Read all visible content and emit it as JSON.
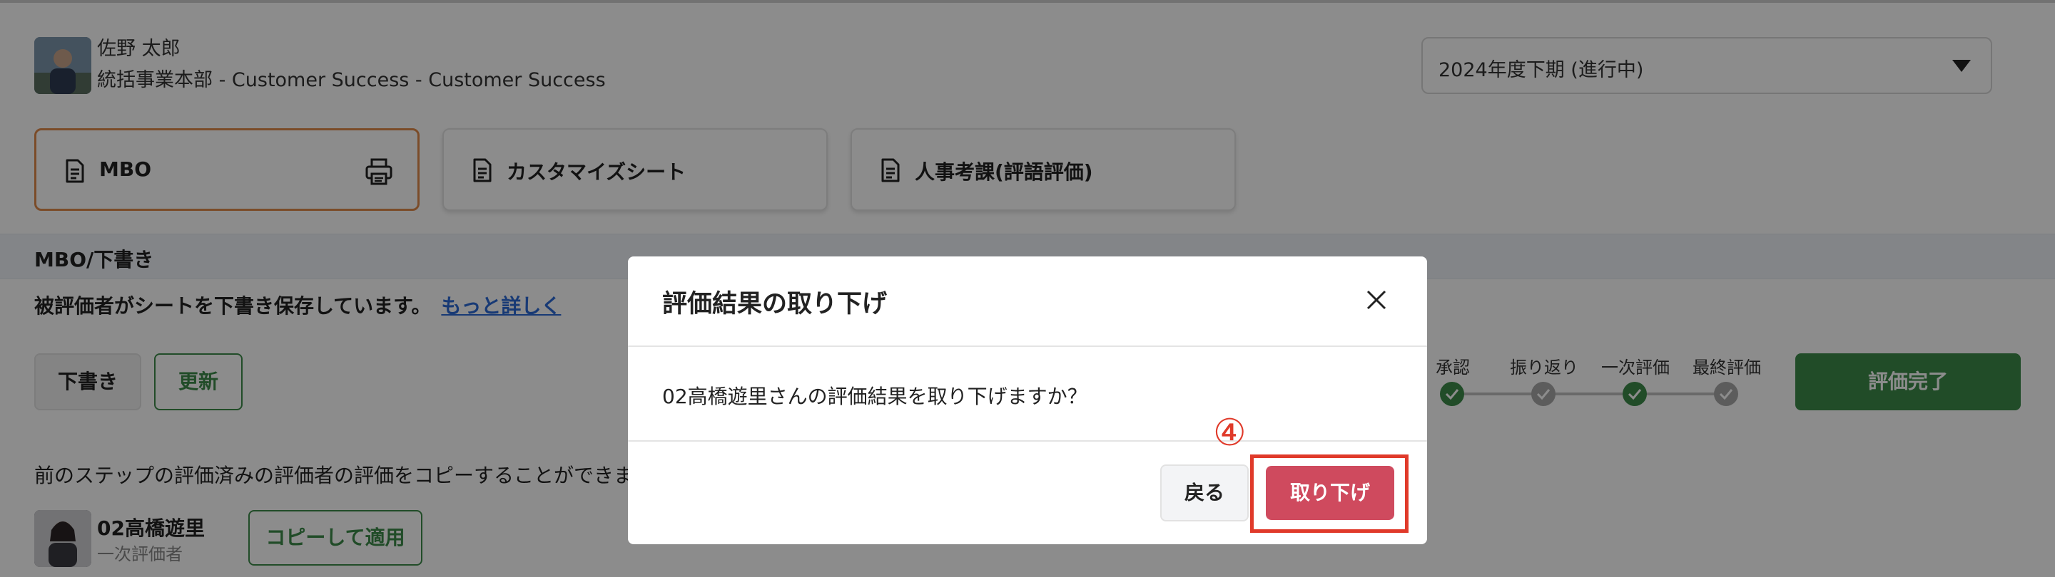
{
  "user": {
    "name": "佐野 太郎",
    "department": "統括事業本部 - Customer Success - Customer Success"
  },
  "period": {
    "selected": "2024年度下期 (進行中)"
  },
  "tabs": [
    {
      "label": "MBO",
      "active": true
    },
    {
      "label": "カスタマイズシート",
      "active": false
    },
    {
      "label": "人事考課(評語評価)",
      "active": false
    }
  ],
  "section": {
    "title": "MBO/下書き",
    "status_message": "被評価者がシートを下書き保存しています。",
    "more_link": "もっと詳しく"
  },
  "actions": {
    "draft_label": "下書き",
    "update_label": "更新",
    "complete_label": "評価完了"
  },
  "steps": [
    {
      "label": "承認",
      "state": "done"
    },
    {
      "label": "振り返り",
      "state": "pending"
    },
    {
      "label": "一次評価",
      "state": "done"
    },
    {
      "label": "最終評価",
      "state": "pending"
    }
  ],
  "copy_section": {
    "message": "前のステップの評価済みの評価者の評価をコピーすることができます",
    "evaluator_name": "02高橋遊里",
    "evaluator_role": "一次評価者",
    "copy_button": "コピーして適用"
  },
  "modal": {
    "title": "評価結果の取り下げ",
    "message": "02高橋遊里さんの評価結果を取り下げますか？",
    "back_label": "戻る",
    "withdraw_label": "取り下げ"
  },
  "annotation": {
    "step_marker": "④"
  },
  "colors": {
    "primary_green": "#3c8a4a",
    "danger": "#cf4a5e",
    "active_tab_border": "#e08a4b",
    "link": "#2d6bd6",
    "annotation_red": "#e03a2a"
  }
}
